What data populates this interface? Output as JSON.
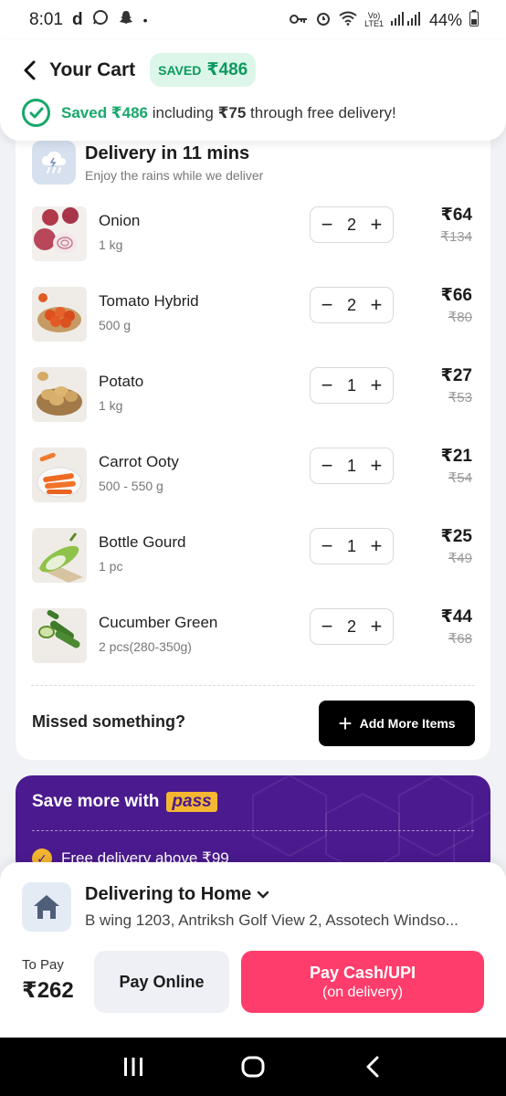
{
  "status_bar": {
    "time": "8:01",
    "notif_d": "d",
    "battery": "44%"
  },
  "header": {
    "title": "Your Cart",
    "saved_label": "SAVED",
    "saved_amount": "₹486",
    "savings_prefix": "Saved ₹486",
    "savings_middle": " including ",
    "savings_amount": "₹75",
    "savings_suffix": " through free delivery!"
  },
  "delivery": {
    "title": "Delivery in 11 mins",
    "subtitle": "Enjoy the rains while we deliver"
  },
  "items": [
    {
      "name": "Onion",
      "unit": "1 kg",
      "qty": "2",
      "price": "₹64",
      "mrp": "₹134"
    },
    {
      "name": "Tomato Hybrid",
      "unit": "500 g",
      "qty": "2",
      "price": "₹66",
      "mrp": "₹80"
    },
    {
      "name": "Potato",
      "unit": "1 kg",
      "qty": "1",
      "price": "₹27",
      "mrp": "₹53"
    },
    {
      "name": "Carrot Ooty",
      "unit": "500 - 550 g",
      "qty": "1",
      "price": "₹21",
      "mrp": "₹54"
    },
    {
      "name": "Bottle Gourd",
      "unit": "1 pc",
      "qty": "1",
      "price": "₹25",
      "mrp": "₹49"
    },
    {
      "name": "Cucumber Green",
      "unit": "2 pcs(280-350g)",
      "qty": "2",
      "price": "₹44",
      "mrp": "₹68"
    }
  ],
  "missed": {
    "label": "Missed something?",
    "button": "Add More Items"
  },
  "pass": {
    "title": "Save more with",
    "logo": "pass",
    "benefit": "Free delivery above ₹99"
  },
  "address": {
    "title": "Delivering to Home",
    "line": "B wing 1203, Antriksh Golf View 2, Assotech Windso..."
  },
  "payment": {
    "to_pay_label": "To Pay",
    "to_pay_value": "₹262",
    "online": "Pay Online",
    "cash_line1": "Pay Cash/UPI",
    "cash_line2": "(on delivery)"
  },
  "colors": {
    "accent_green": "#18a86b",
    "pay_button": "#ff3d6c",
    "pass_purple": "#4b1a8f",
    "pass_gold": "#f5b731"
  }
}
